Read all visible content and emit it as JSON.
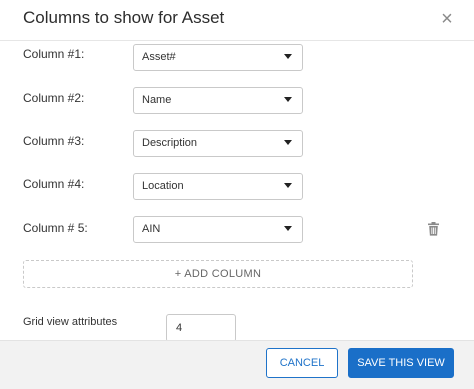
{
  "dialog": {
    "title": "Columns to show for Asset",
    "close_icon": "×"
  },
  "columns": [
    {
      "label": "Column #1:",
      "value": "Asset#"
    },
    {
      "label": "Column #2:",
      "value": "Name"
    },
    {
      "label": "Column #3:",
      "value": "Description"
    },
    {
      "label": "Column #4:",
      "value": "Location"
    },
    {
      "label": "Column # 5:",
      "value": "AIN"
    }
  ],
  "add_column": "+ ADD COLUMN",
  "grid_view": {
    "label": "Grid view attributes",
    "value": "4"
  },
  "footer": {
    "cancel": "CANCEL",
    "save": "SAVE THIS VIEW"
  },
  "colors": {
    "accent": "#1a6fc8"
  },
  "icons": {
    "close": "close-icon",
    "dropdown": "chevron-down-icon",
    "delete": "trash-icon"
  }
}
